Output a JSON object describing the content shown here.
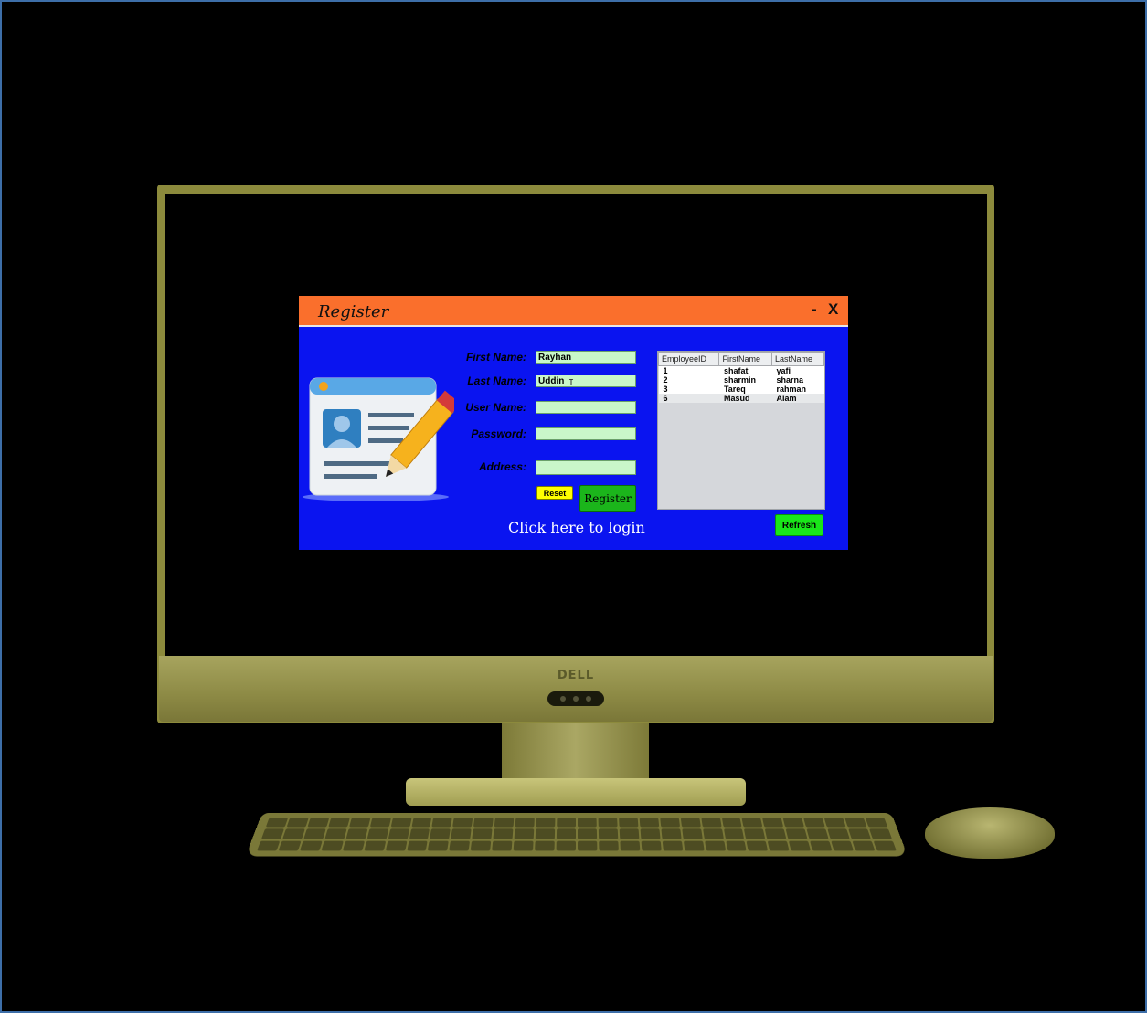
{
  "hardware": {
    "brand": "DELL"
  },
  "window": {
    "title": "Register",
    "minimize_label": "-",
    "close_label": "X"
  },
  "form": {
    "first_name": {
      "label": "First Name:",
      "value": "Rayhan"
    },
    "last_name": {
      "label": "Last Name:",
      "value": "Uddin"
    },
    "user_name": {
      "label": "User Name:",
      "value": ""
    },
    "password": {
      "label": "Password:",
      "value": ""
    },
    "address": {
      "label": "Address:",
      "value": ""
    },
    "reset_label": "Reset",
    "register_label": "Register",
    "login_link": "Click here to login"
  },
  "employees_table": {
    "columns": [
      "EmployeeID",
      "FirstName",
      "LastName"
    ],
    "rows": [
      [
        "1",
        "shafat",
        "yafi"
      ],
      [
        "2",
        "sharmin",
        "sharna"
      ],
      [
        "3",
        "Tareq",
        "rahman"
      ],
      [
        "6",
        "Masud",
        "Alam"
      ]
    ],
    "refresh_label": "Refresh"
  },
  "colors": {
    "titlebar": "#fa6f2c",
    "window_bg": "#0a14f0",
    "field_bg": "#c9f7c9",
    "register_button": "#1bb51b",
    "reset_button": "#ffff00",
    "refresh_button": "#19e619"
  },
  "icons": {
    "illustration": "registration-card-pencil-icon"
  }
}
